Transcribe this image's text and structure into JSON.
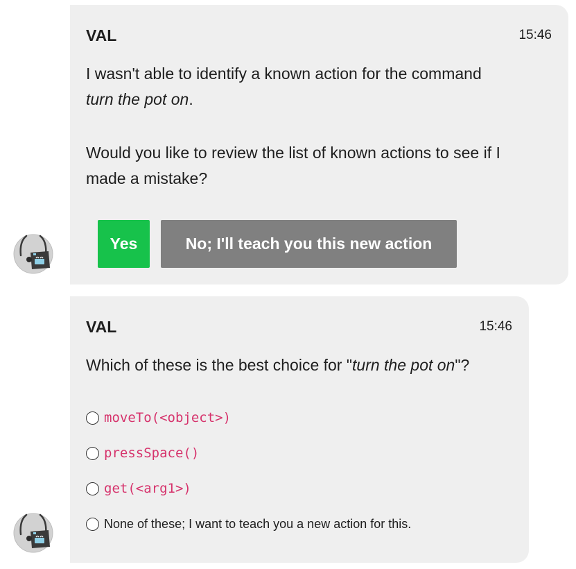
{
  "messages": [
    {
      "sender": "VAL",
      "time": "15:46",
      "line1": "I wasn't able to identify a known action for the command",
      "command": "turn the pot on",
      "command_suffix": ".",
      "line3": "Would you like to review the list of known actions to see if I",
      "line4": "made a mistake?",
      "buttons": {
        "yes_label": "Yes",
        "no_label": "No; I'll teach you this new action",
        "yes_color": "#17c24b",
        "no_color": "#808080"
      }
    },
    {
      "sender": "VAL",
      "time": "15:46",
      "question_prefix": "Which of these is the best choice for \"",
      "question_command": "turn the pot on",
      "question_suffix": "\"?",
      "options": [
        {
          "label": "moveTo(<object>)",
          "style": "code"
        },
        {
          "label": "pressSpace()",
          "style": "code"
        },
        {
          "label": "get(<arg1>)",
          "style": "code"
        },
        {
          "label": "None of these; I want to teach you a new action for this.",
          "style": "plain"
        }
      ]
    }
  ],
  "avatar": {
    "icon": "robot-avatar-icon"
  },
  "colors": {
    "bubble_bg": "#efefef",
    "code_text": "#d6336c"
  }
}
